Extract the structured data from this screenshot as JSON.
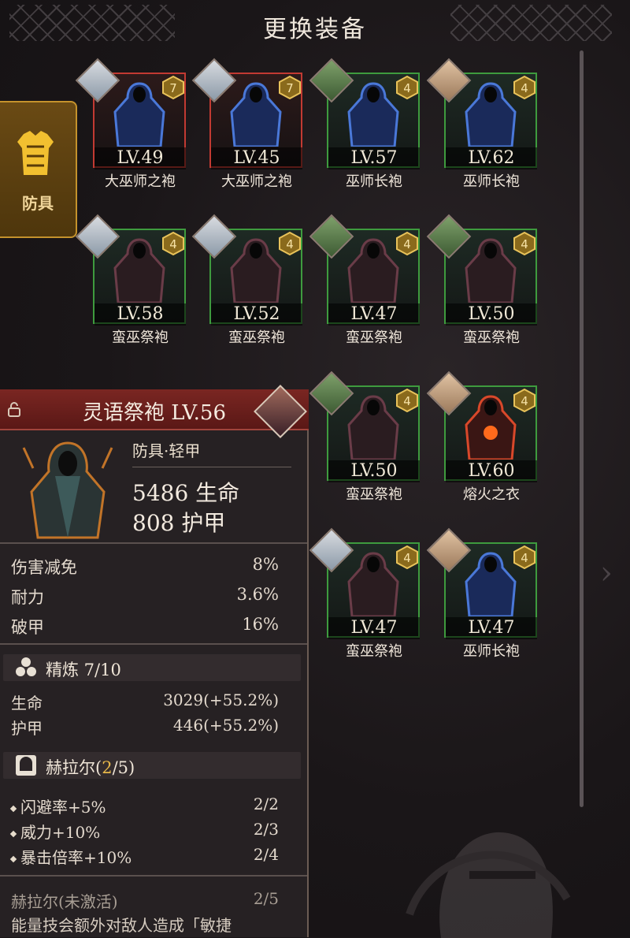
{
  "header": {
    "title": "更换装备"
  },
  "side_tab": {
    "label": "防具",
    "icon": "chest-armor-icon"
  },
  "grid_items": [
    {
      "level": "LV.49",
      "name": "大巫师之袍",
      "rarity": "red",
      "rank": "7",
      "robe": "blue"
    },
    {
      "level": "LV.45",
      "name": "大巫师之袍",
      "rarity": "red",
      "rank": "7",
      "robe": "blue"
    },
    {
      "level": "LV.57",
      "name": "巫师长袍",
      "rarity": "green",
      "rank": "4",
      "robe": "blue"
    },
    {
      "level": "LV.62",
      "name": "巫师长袍",
      "rarity": "green",
      "rank": "4",
      "robe": "blue"
    },
    {
      "level": "LV.58",
      "name": "蛮巫祭袍",
      "rarity": "green",
      "rank": "4",
      "robe": "dark"
    },
    {
      "level": "LV.52",
      "name": "蛮巫祭袍",
      "rarity": "green",
      "rank": "4",
      "robe": "dark"
    },
    {
      "level": "LV.47",
      "name": "蛮巫祭袍",
      "rarity": "green",
      "rank": "4",
      "robe": "dark"
    },
    {
      "level": "LV.50",
      "name": "蛮巫祭袍",
      "rarity": "green",
      "rank": "4",
      "robe": "dark"
    },
    {
      "level": "LV.50",
      "name": "蛮巫祭袍",
      "rarity": "green",
      "rank": "4",
      "robe": "dark"
    },
    {
      "level": "LV.60",
      "name": "熔火之衣",
      "rarity": "green",
      "rank": "4",
      "robe": "lava"
    },
    {
      "level": "LV.47",
      "name": "蛮巫祭袍",
      "rarity": "green",
      "rank": "4",
      "robe": "dark"
    },
    {
      "level": "LV.47",
      "name": "巫师长袍",
      "rarity": "green",
      "rank": "4",
      "robe": "blue"
    }
  ],
  "detail": {
    "title": "灵语祭袍 LV.56",
    "type": "防具·轻甲",
    "hp": "5486 生命",
    "armor": "808 护甲",
    "stats": [
      {
        "label": "伤害减免",
        "value": "8%"
      },
      {
        "label": "耐力",
        "value": "3.6%"
      },
      {
        "label": "破甲",
        "value": "16%"
      }
    ],
    "refine": {
      "label": "精炼 7/10",
      "rows": [
        {
          "label": "生命",
          "value": "3029(+55.2%)"
        },
        {
          "label": "护甲",
          "value": "446(+55.2%)"
        }
      ]
    },
    "set": {
      "label_prefix": "赫拉尔(",
      "count": "2",
      "label_suffix": "/5)",
      "bonuses": [
        {
          "label": "闪避率+5%",
          "value": "2/2"
        },
        {
          "label": "威力+10%",
          "value": "2/3"
        },
        {
          "label": "暴击倍率+10%",
          "value": "2/4"
        }
      ],
      "inactive_label": "赫拉尔(未激活)",
      "inactive_value": "2/5",
      "desc": "能量技会额外对敌人造成「敏捷"
    }
  },
  "colors": {
    "rare_red": "#c23a32",
    "common_green": "#3e9b3e",
    "accent_gold": "#e8b84a"
  }
}
